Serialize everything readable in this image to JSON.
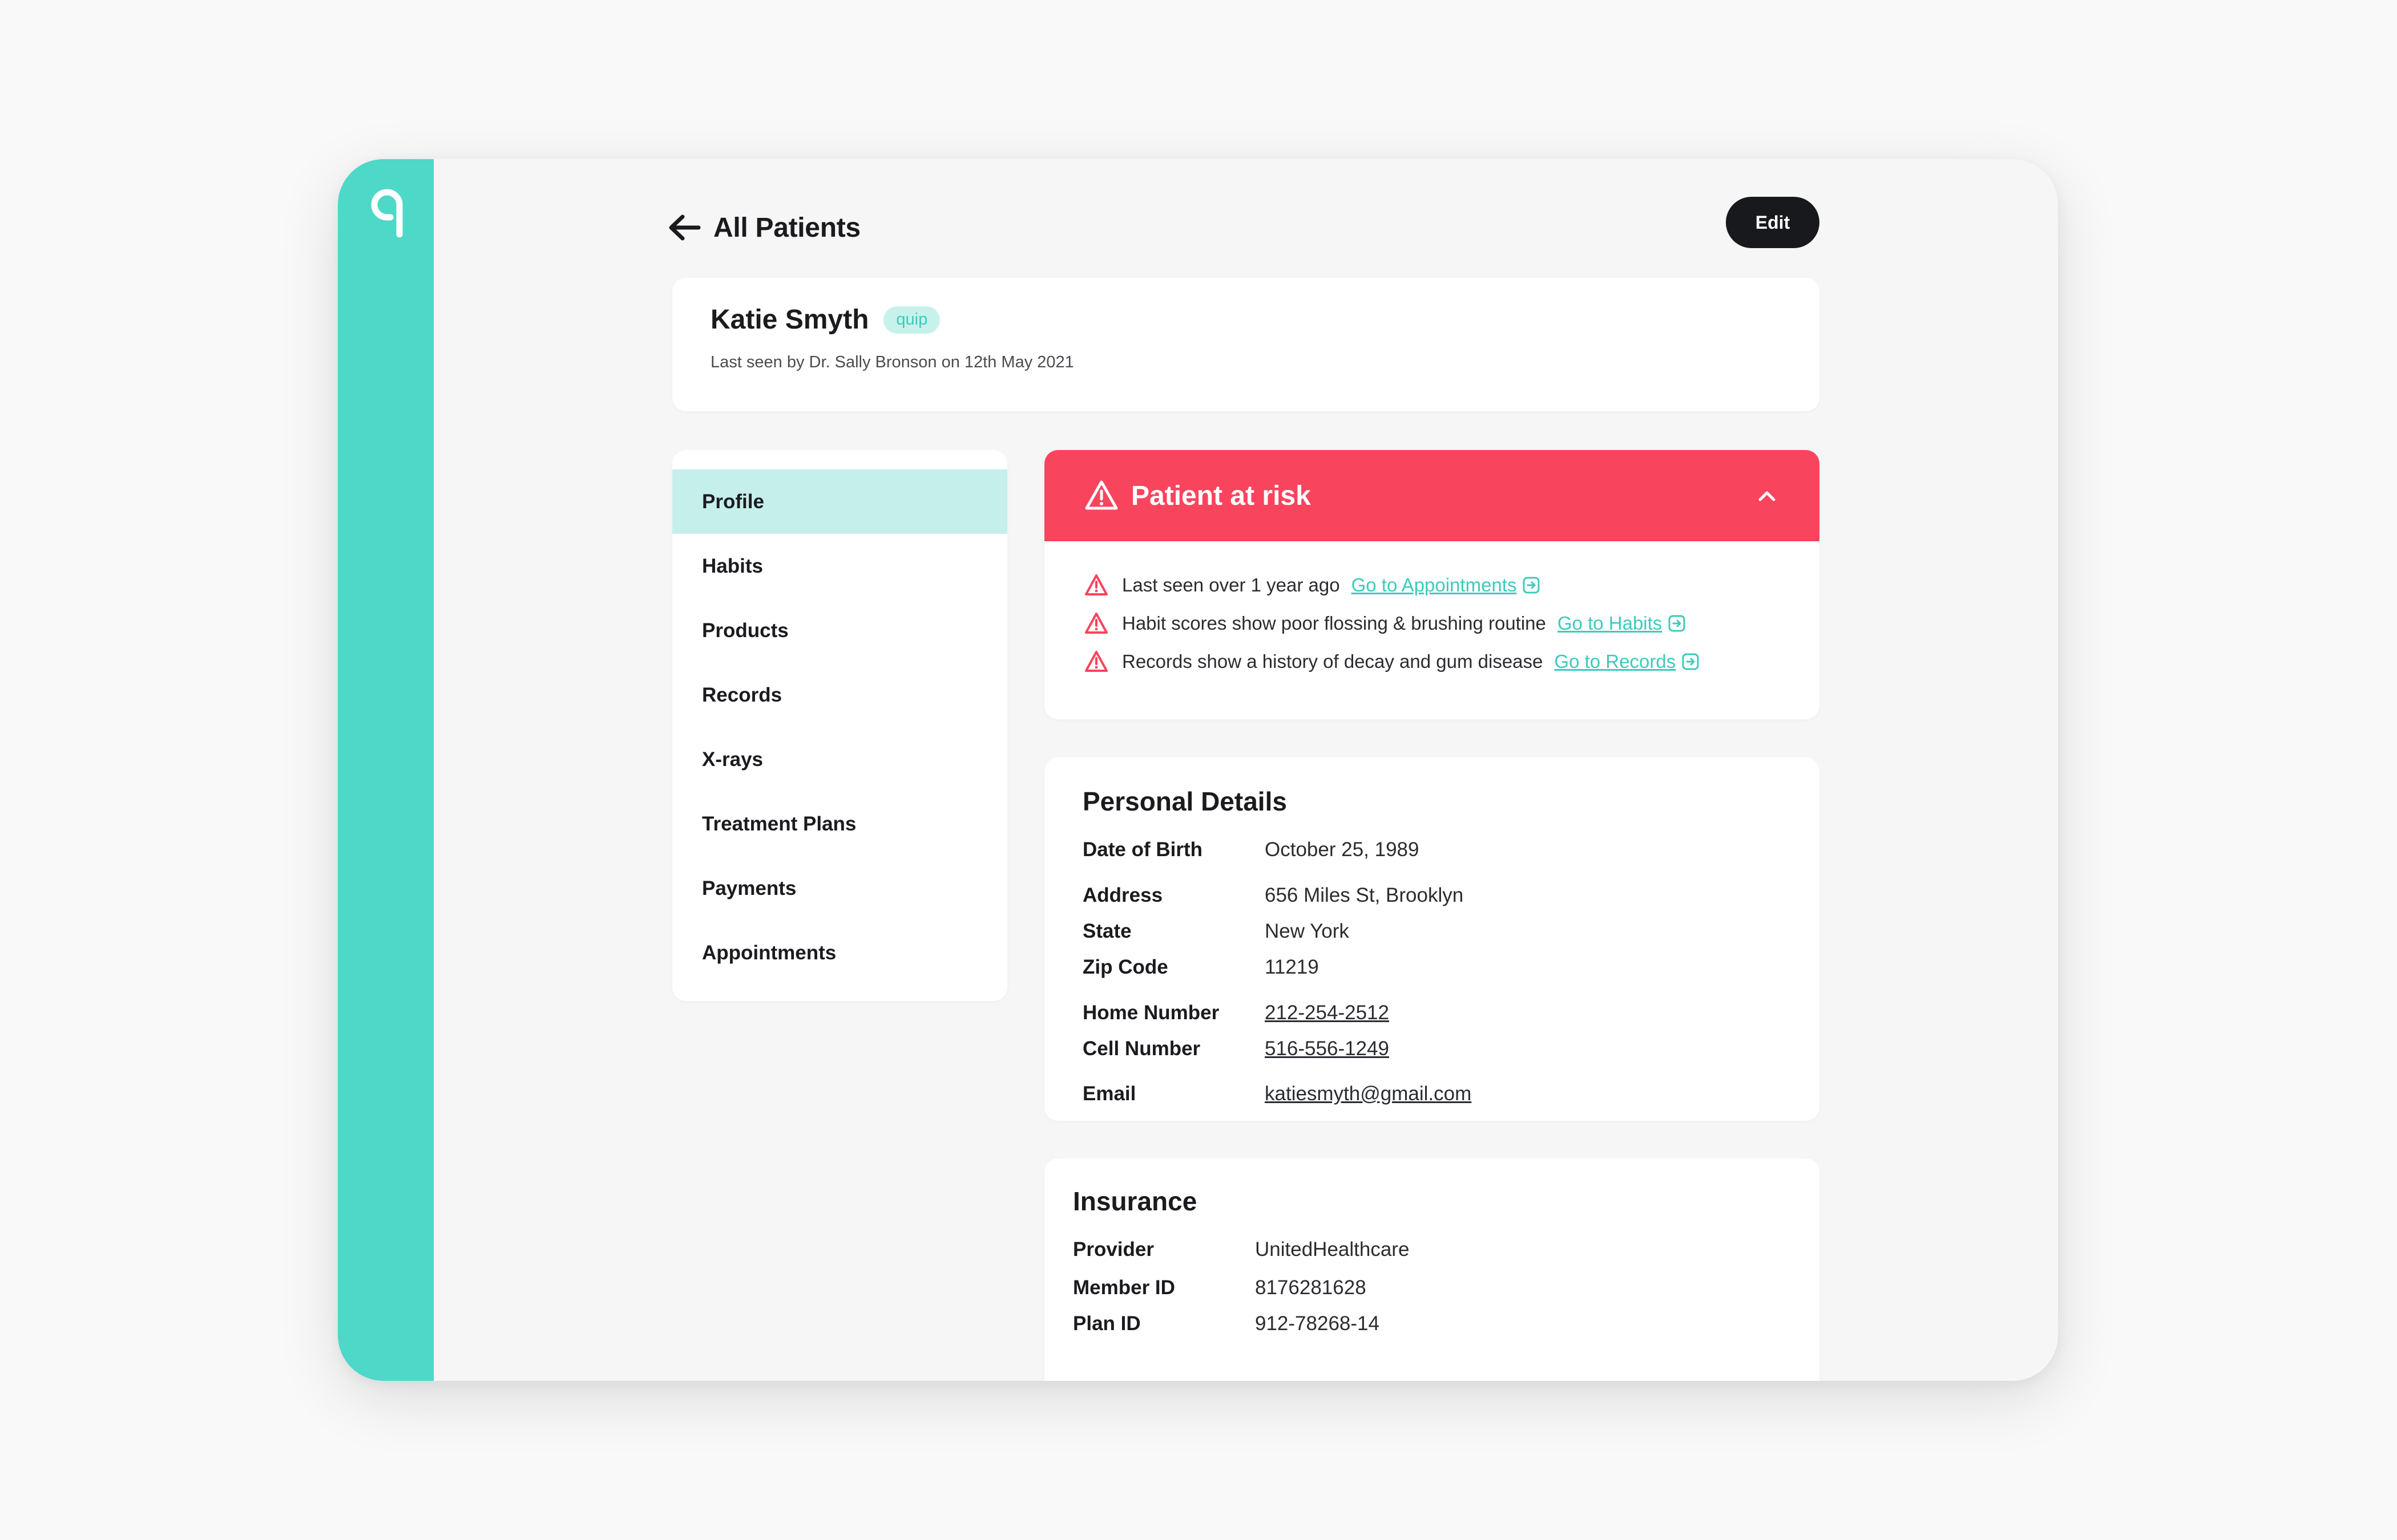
{
  "header": {
    "back_label": "All Patients",
    "edit_label": "Edit"
  },
  "patient": {
    "name": "Katie Smyth",
    "badge": "quip",
    "last_seen": "Last seen by Dr. Sally Bronson on 12th May 2021"
  },
  "nav": {
    "items": [
      {
        "label": "Profile",
        "active": true
      },
      {
        "label": "Habits"
      },
      {
        "label": "Products"
      },
      {
        "label": "Records"
      },
      {
        "label": "X-rays"
      },
      {
        "label": "Treatment Plans"
      },
      {
        "label": "Payments"
      },
      {
        "label": "Appointments"
      }
    ]
  },
  "risk": {
    "title": "Patient at risk",
    "items": [
      {
        "text": "Last seen over 1 year ago",
        "link": "Go to Appointments"
      },
      {
        "text": "Habit scores show poor flossing & brushing routine",
        "link": "Go to Habits"
      },
      {
        "text": "Records show a history of decay and gum disease",
        "link": "Go to Records"
      }
    ]
  },
  "personal": {
    "title": "Personal Details",
    "rows": [
      {
        "label": "Date of Birth",
        "value": "October 25, 1989"
      },
      {
        "label": "Address",
        "value": "656 Miles St, Brooklyn"
      },
      {
        "label": "State",
        "value": "New York"
      },
      {
        "label": "Zip Code",
        "value": "11219"
      },
      {
        "label": "Home Number",
        "value": "212-254-2512"
      },
      {
        "label": "Cell Number",
        "value": "516-556-1249"
      },
      {
        "label": "Email",
        "value": "katiesmyth@gmail.com"
      }
    ]
  },
  "insurance": {
    "title": "Insurance",
    "rows": [
      {
        "label": "Provider",
        "value": "UnitedHealthcare"
      },
      {
        "label": "Member ID",
        "value": "8176281628"
      },
      {
        "label": "Plan ID",
        "value": "912-78268-14"
      }
    ]
  },
  "colors": {
    "brand": "#4dd8c8",
    "risk": "#f9445d",
    "link": "#3ccbba",
    "active_nav": "#c5efea"
  },
  "icons": [
    "quip-logo-icon",
    "arrow-left-icon",
    "warning-icon",
    "chevron-up-icon",
    "external-link-icon"
  ]
}
